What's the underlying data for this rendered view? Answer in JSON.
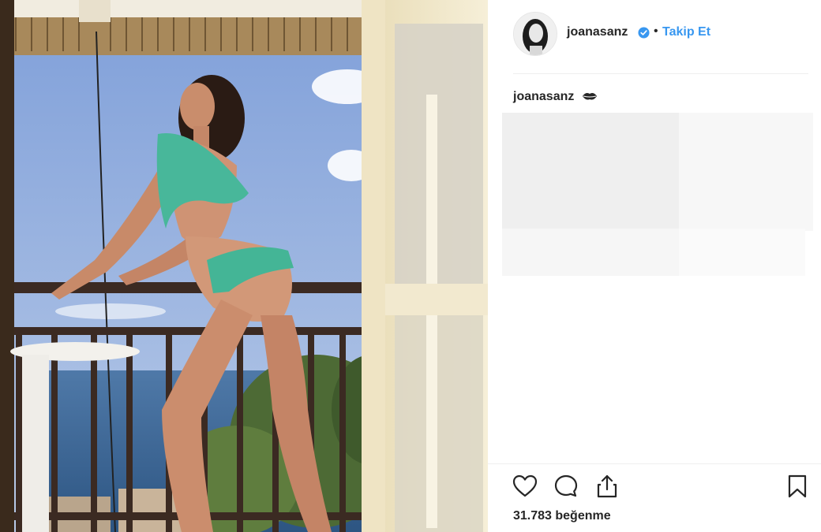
{
  "post": {
    "username": "joanasanz",
    "follow_label": "Takip Et",
    "separator": "•",
    "caption_username": "joanasanz",
    "likes_text": "31.783 beğenme"
  },
  "icons": {
    "verified": "verified-badge-icon",
    "caption_emoji": "kiss-lips-icon",
    "like": "heart-icon",
    "comment": "comment-icon",
    "share": "share-icon",
    "save": "bookmark-icon"
  },
  "colors": {
    "accent": "#3897f0",
    "text": "#262626",
    "divider": "#efefef"
  }
}
